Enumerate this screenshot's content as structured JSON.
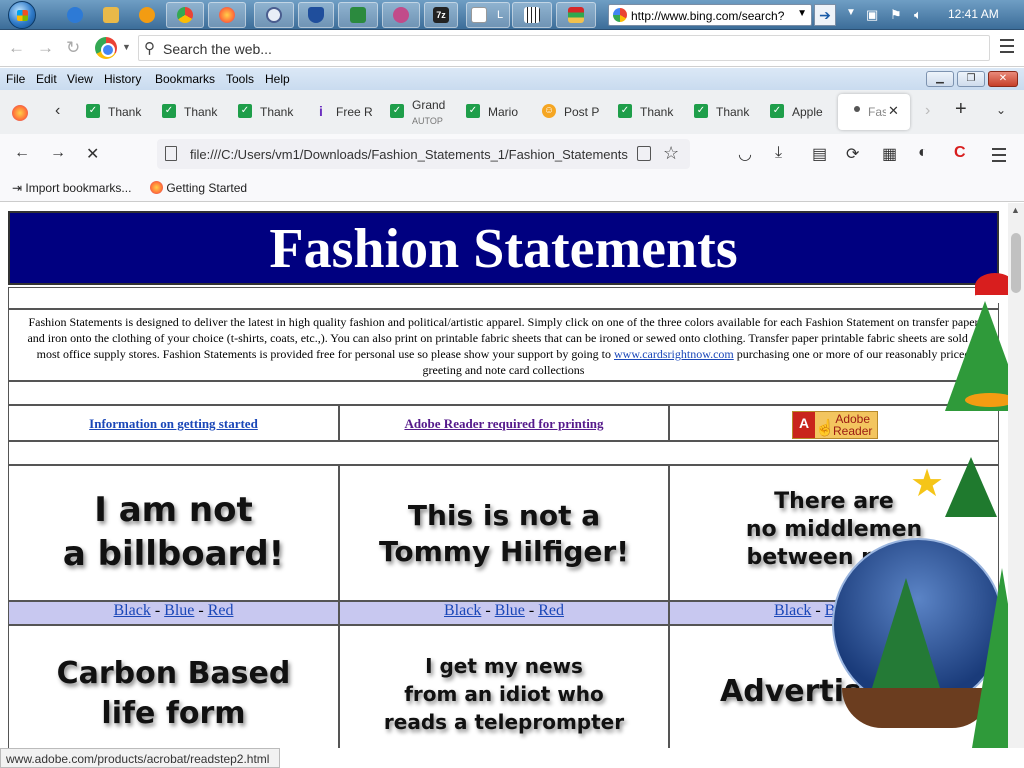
{
  "taskbar": {
    "apps": [
      {
        "icon": "ie-icon",
        "color": "#2d7ad6"
      },
      {
        "icon": "folder-icon",
        "color": "#e9b949"
      },
      {
        "icon": "media-player-icon",
        "color": "#f39c12"
      },
      {
        "icon": "chrome-icon",
        "color": "#34a853"
      },
      {
        "icon": "firefox-icon",
        "color": "#ff7139"
      },
      {
        "icon": "app-a-icon",
        "color": "#4a5d8f"
      },
      {
        "icon": "shield-app-icon",
        "color": "#1f4e9c"
      },
      {
        "icon": "chart-app-icon",
        "color": "#2b8a3e"
      },
      {
        "icon": "paint-app-icon",
        "color": "#c14b8a"
      },
      {
        "icon": "7zip-icon",
        "color": "#222222"
      },
      {
        "icon": "document-icon",
        "color": "#ffffff"
      },
      {
        "icon": "piano-icon",
        "color": "#f4f4f4"
      },
      {
        "icon": "equalizer-icon",
        "color": "#d62828"
      }
    ],
    "doc_label": "L",
    "seven_zip_label": "7z",
    "address": "http://www.bing.com/search?",
    "clock": "12:41 AM"
  },
  "chrome": {
    "search_placeholder": "Search the web..."
  },
  "firefox": {
    "menu": [
      "File",
      "Edit",
      "View",
      "History",
      "Bookmarks",
      "Tools",
      "Help"
    ],
    "tabs": [
      {
        "label": "Thank",
        "fav": "green",
        "icon": "check-icon"
      },
      {
        "label": "Thank",
        "fav": "green",
        "icon": "check-icon"
      },
      {
        "label": "Thank",
        "fav": "green",
        "icon": "check-icon"
      },
      {
        "label": "Free R",
        "fav": "purple",
        "icon": "info-icon"
      },
      {
        "label": "Grand",
        "sub": "AUTOP",
        "fav": "green",
        "icon": "check-icon"
      },
      {
        "label": "Mario",
        "fav": "green",
        "icon": "check-icon"
      },
      {
        "label": "Post P",
        "fav": "orange",
        "icon": "smiley-icon"
      },
      {
        "label": "Thank",
        "fav": "green",
        "icon": "check-icon"
      },
      {
        "label": "Thank",
        "fav": "green",
        "icon": "check-icon"
      },
      {
        "label": "Apple",
        "fav": "green",
        "icon": "check-icon"
      },
      {
        "label": "Fas",
        "fav": "none",
        "icon": "loading-dot-icon"
      }
    ],
    "url": "file:///C:/Users/vm1/Downloads/Fashion_Statements_1/Fashion_Statements",
    "bookmarks": [
      {
        "label": "Import bookmarks...",
        "icon": "import-icon"
      },
      {
        "label": "Getting Started",
        "icon": "firefox-icon"
      }
    ]
  },
  "page": {
    "title": "Fashion Statements",
    "intro_part1": "Fashion Statements is designed to deliver the latest in high quality fashion and political/artistic apparel. Simply click on one of the three colors available for each Fashion Statement on transfer paper and iron onto the clothing of your choice (t-shirts, coats, etc.,). You can also print on printable fabric sheets that can be ironed or sewed onto clothing. Transfer paper printable fabric sheets are sold at most office supply stores. Fashion Statements is provided free for personal use so please show your support by going to ",
    "intro_link": "www.cardsrightnow.com",
    "intro_part2": " purchasing one or more of our reasonably priced greeting and note card collections",
    "info_link": "Information on getting started",
    "adobe_link": "Adobe Reader required for printing",
    "adobe_badge_a": "A",
    "adobe_badge_word1": "Adobe",
    "adobe_badge_word2": "Reader",
    "shirts_row1": [
      {
        "line1": "I am not",
        "line2": "a billboard!"
      },
      {
        "line1": "This is not a",
        "line2": "Tommy Hilfiger!"
      },
      {
        "line1": "There are",
        "line2": "no middlemen",
        "line3": "between me a"
      }
    ],
    "shirts_row2": [
      {
        "line1": "Carbon Based",
        "line2": "life form"
      },
      {
        "line1": "I get my news",
        "line2": "from an idiot who",
        "line3": "reads a teleprompter"
      },
      {
        "line1": "Advertis",
        "line2": ""
      }
    ],
    "colors": [
      "Black",
      "Blue",
      "Red"
    ],
    "color_sep": " - ",
    "partial_third": "Bl"
  },
  "status_url": "www.adobe.com/products/acrobat/readstep2.html"
}
